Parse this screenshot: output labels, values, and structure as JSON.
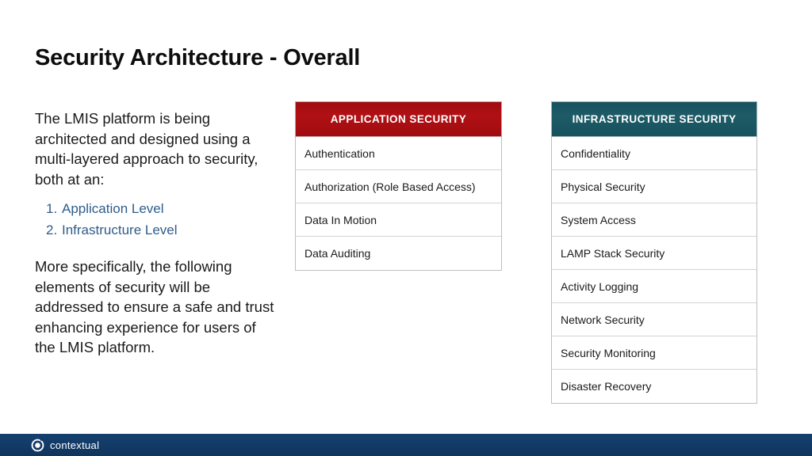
{
  "slide": {
    "title": "Security Architecture - Overall"
  },
  "left": {
    "paragraph1": "The LMIS platform is being architected and designed using a multi-layered approach to security, both at an:",
    "list": [
      {
        "marker": "1.",
        "label": "Application Level"
      },
      {
        "marker": "2.",
        "label": "Infrastructure Level"
      }
    ],
    "paragraph2": "More specifically, the following elements of security will be addressed to ensure a safe and trust enhancing experience for users of the LMIS platform."
  },
  "tables": {
    "application": {
      "header": "APPLICATION SECURITY",
      "header_color": "#a50e10",
      "rows": [
        "Authentication",
        "Authorization (Role Based Access)",
        "Data In Motion",
        "Data Auditing"
      ]
    },
    "infrastructure": {
      "header": "INFRASTRUCTURE SECURITY",
      "header_color": "#1a5560",
      "rows": [
        "Confidentiality",
        "Physical Security",
        "System Access",
        "LAMP Stack Security",
        "Activity Logging",
        "Network Security",
        "Security Monitoring",
        "Disaster Recovery"
      ]
    }
  },
  "footer": {
    "brand": "contextual",
    "logo_icon": "target-circle-icon",
    "bar_color": "#123a66"
  },
  "colors": {
    "list_text": "#2e5c8a",
    "body_text": "#1a1a1a"
  }
}
